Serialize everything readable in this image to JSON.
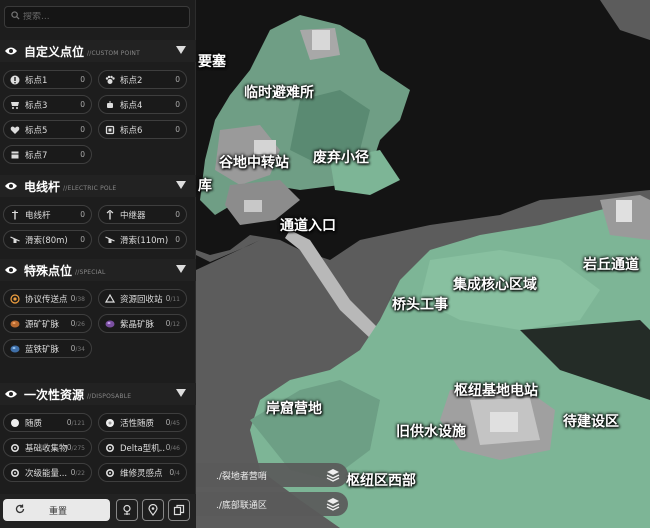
{
  "search": {
    "placeholder": "搜索..."
  },
  "sections": [
    {
      "title": "自定义点位",
      "subtitle": "//CUSTOM POINT",
      "items": [
        {
          "label": "标点1",
          "count": "0",
          "icon": "info-icon"
        },
        {
          "label": "标点2",
          "count": "0",
          "icon": "paw-icon"
        },
        {
          "label": "标点3",
          "count": "0",
          "icon": "cart-icon"
        },
        {
          "label": "标点4",
          "count": "0",
          "icon": "robot-icon"
        },
        {
          "label": "标点5",
          "count": "0",
          "icon": "heart-icon"
        },
        {
          "label": "标点6",
          "count": "0",
          "icon": "cube-icon"
        },
        {
          "label": "标点7",
          "count": "0",
          "icon": "box-icon"
        }
      ]
    },
    {
      "title": "电线杆",
      "subtitle": "//ELECTRIC POLE",
      "items": [
        {
          "label": "电线杆",
          "count": "0",
          "icon": "pole-icon"
        },
        {
          "label": "中继器",
          "count": "0",
          "icon": "relay-icon"
        },
        {
          "label": "滑索(80m)",
          "count": "0",
          "icon": "zipline-icon"
        },
        {
          "label": "滑索(110m)",
          "count": "0",
          "icon": "zipline-icon"
        }
      ]
    },
    {
      "title": "特殊点位",
      "subtitle": "//SPECIAL",
      "items": [
        {
          "label": "协议传送点",
          "count": "0",
          "total": "/38",
          "icon": "teleport-icon"
        },
        {
          "label": "资源回收站",
          "count": "0",
          "total": "/11",
          "icon": "recycle-icon"
        },
        {
          "label": "源矿矿脉",
          "count": "0",
          "total": "/26",
          "icon": "ore-orange-icon"
        },
        {
          "label": "紫晶矿脉",
          "count": "0",
          "total": "/12",
          "icon": "ore-purple-icon"
        },
        {
          "label": "蓝铁矿脉",
          "count": "0",
          "total": "/34",
          "icon": "ore-blue-icon"
        }
      ]
    },
    {
      "title": "一次性资源",
      "subtitle": "//DISPOSABLE",
      "items": [
        {
          "label": "随质",
          "count": "0",
          "total": "/121",
          "icon": "orb-icon"
        },
        {
          "label": "活性随质",
          "count": "0",
          "total": "/45",
          "icon": "orb-icon"
        },
        {
          "label": "基础收集物",
          "count": "0",
          "total": "/275",
          "icon": "gear-icon"
        },
        {
          "label": "Delta型机...",
          "count": "0",
          "total": "/46",
          "icon": "gear-icon"
        },
        {
          "label": "次级能量...",
          "count": "0",
          "total": "/22",
          "icon": "gear-icon"
        },
        {
          "label": "维修灵感点",
          "count": "0",
          "total": "/4",
          "icon": "gear-icon"
        }
      ]
    }
  ],
  "bottom": {
    "reset_label": "重置"
  },
  "floors": [
    "./裂地者营哨",
    "./底部联通区"
  ],
  "map_labels": [
    "要塞",
    "临时避难所",
    "谷地中转站",
    "废弃小径",
    "库",
    "通道入口",
    "集成核心区域",
    "岩丘通道",
    "桥头工事",
    "岸窟营地",
    "枢纽基地电站",
    "旧供水设施",
    "待建设区",
    "枢纽区西部"
  ],
  "colors": {
    "accent": "#f0a040",
    "land": "#7db596",
    "rock": "#131313",
    "void": "#5c5c5c"
  }
}
